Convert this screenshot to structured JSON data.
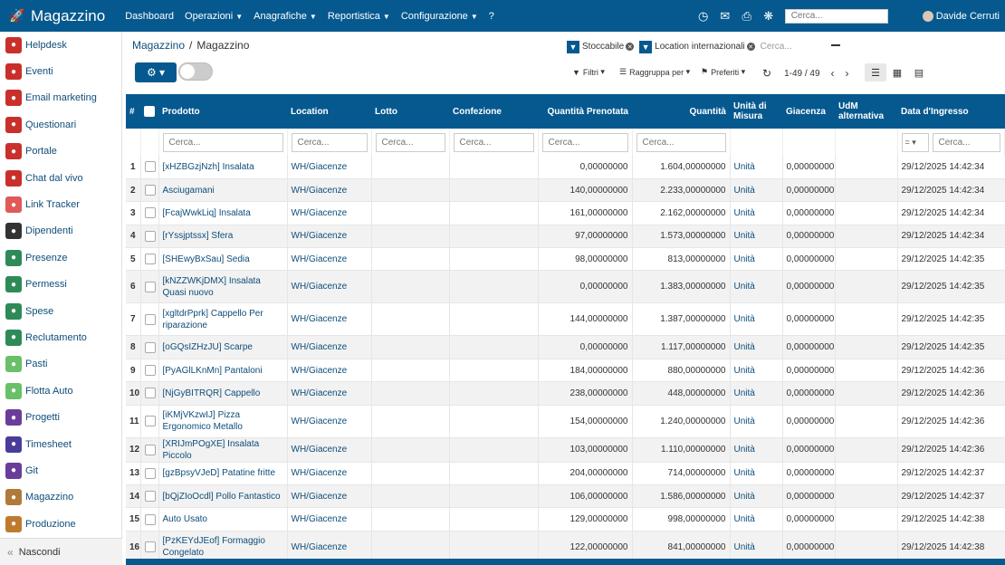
{
  "topbar": {
    "brand": "Magazzino",
    "menu": [
      "Dashboard",
      "Operazioni",
      "Anagrafiche",
      "Reportistica",
      "Configurazione",
      "?"
    ],
    "search_placeholder": "Cerca...",
    "user": "Davide Cerruti",
    "icons": [
      "rocket-icon",
      "clock-icon",
      "chat-icon",
      "print-icon",
      "loading-icon"
    ]
  },
  "sidebar": {
    "items": [
      {
        "label": "Helpdesk",
        "color": "#c9302c",
        "icon": "helpdesk-icon"
      },
      {
        "label": "Eventi",
        "color": "#c9302c",
        "icon": "ticket-icon"
      },
      {
        "label": "Email marketing",
        "color": "#c9302c",
        "icon": "paper-plane-icon"
      },
      {
        "label": "Questionari",
        "color": "#c9302c",
        "icon": "clipboard-icon"
      },
      {
        "label": "Portale",
        "color": "#c9302c",
        "icon": "globe-icon"
      },
      {
        "label": "Chat dal vivo",
        "color": "#c9302c",
        "icon": "chat-icon"
      },
      {
        "label": "Link Tracker",
        "color": "#e05a5a",
        "icon": "link-icon"
      },
      {
        "label": "Dipendenti",
        "color": "#333333",
        "icon": "people-icon"
      },
      {
        "label": "Presenze",
        "color": "#2e8b57",
        "icon": "person-icon"
      },
      {
        "label": "Permessi",
        "color": "#2e8b57",
        "icon": "sun-icon"
      },
      {
        "label": "Spese",
        "color": "#2e8b57",
        "icon": "dollar-icon"
      },
      {
        "label": "Reclutamento",
        "color": "#2e8b57",
        "icon": "search-person-icon"
      },
      {
        "label": "Pasti",
        "color": "#6abf69",
        "icon": "cutlery-icon"
      },
      {
        "label": "Flotta Auto",
        "color": "#6abf69",
        "icon": "car-icon"
      },
      {
        "label": "Progetti",
        "color": "#6a3d9a",
        "icon": "puzzle-icon"
      },
      {
        "label": "Timesheet",
        "color": "#4a3d9a",
        "icon": "clock-icon"
      },
      {
        "label": "Git",
        "color": "#6a3d9a",
        "icon": "git-icon"
      },
      {
        "label": "Magazzino",
        "color": "#b07a3a",
        "icon": "box-icon"
      },
      {
        "label": "Produzione",
        "color": "#c07a30",
        "icon": "wrench-icon"
      }
    ],
    "hide_label": "Nascondi"
  },
  "breadcrumb": {
    "parent": "Magazzino",
    "separator": "/",
    "current": "Magazzino"
  },
  "search": {
    "facets": [
      "Stoccabile",
      "Location internazionali"
    ],
    "placeholder": "Cerca..."
  },
  "toolbar": {
    "filters": "Filtri",
    "group_by": "Raggruppa per",
    "favorites": "Preferiti",
    "pager": "1-49 / 49"
  },
  "table": {
    "columns": [
      "#",
      "",
      "Prodotto",
      "Location",
      "Lotto",
      "Confezione",
      "Quantità Prenotata",
      "Quantità",
      "Unità di Misura",
      "Giacenza",
      "UdM alternativa",
      "Data d'Ingresso"
    ],
    "filter_placeholder": "Cerca...",
    "date_operator": "=",
    "rows": [
      {
        "idx": "1",
        "product": "[xHZBGzjNzh] Insalata",
        "location": "WH/Giacenze",
        "reserved": "0,00000000",
        "qty": "1.604,00000000",
        "uom": "Unità",
        "stock": "0,00000000",
        "date": "29/12/2025 14:42:34",
        "tall": false
      },
      {
        "idx": "2",
        "product": "Asciugamani",
        "location": "WH/Giacenze",
        "reserved": "140,00000000",
        "qty": "2.233,00000000",
        "uom": "Unità",
        "stock": "0,00000000",
        "date": "29/12/2025 14:42:34",
        "tall": false
      },
      {
        "idx": "3",
        "product": "[FcajWwkLiq] Insalata",
        "location": "WH/Giacenze",
        "reserved": "161,00000000",
        "qty": "2.162,00000000",
        "uom": "Unità",
        "stock": "0,00000000",
        "date": "29/12/2025 14:42:34",
        "tall": false
      },
      {
        "idx": "4",
        "product": "[rYssjptssx] Sfera",
        "location": "WH/Giacenze",
        "reserved": "97,00000000",
        "qty": "1.573,00000000",
        "uom": "Unità",
        "stock": "0,00000000",
        "date": "29/12/2025 14:42:34",
        "tall": false
      },
      {
        "idx": "5",
        "product": "[SHEwyBxSau] Sedia",
        "location": "WH/Giacenze",
        "reserved": "98,00000000",
        "qty": "813,00000000",
        "uom": "Unità",
        "stock": "0,00000000",
        "date": "29/12/2025 14:42:35",
        "tall": false
      },
      {
        "idx": "6",
        "product": "[kNZZWKjDMX] Insalata Quasi nuovo",
        "location": "WH/Giacenze",
        "reserved": "0,00000000",
        "qty": "1.383,00000000",
        "uom": "Unità",
        "stock": "0,00000000",
        "date": "29/12/2025 14:42:35",
        "tall": true
      },
      {
        "idx": "7",
        "product": "[xgltdrPprk] Cappello Per riparazione",
        "location": "WH/Giacenze",
        "reserved": "144,00000000",
        "qty": "1.387,00000000",
        "uom": "Unità",
        "stock": "0,00000000",
        "date": "29/12/2025 14:42:35",
        "tall": true
      },
      {
        "idx": "8",
        "product": "[oGQsIZHzJU] Scarpe",
        "location": "WH/Giacenze",
        "reserved": "0,00000000",
        "qty": "1.117,00000000",
        "uom": "Unità",
        "stock": "0,00000000",
        "date": "29/12/2025 14:42:35",
        "tall": false
      },
      {
        "idx": "9",
        "product": "[PyAGlLKnMn] Pantaloni",
        "location": "WH/Giacenze",
        "reserved": "184,00000000",
        "qty": "880,00000000",
        "uom": "Unità",
        "stock": "0,00000000",
        "date": "29/12/2025 14:42:36",
        "tall": false
      },
      {
        "idx": "10",
        "product": "[NjGyBITRQR] Cappello",
        "location": "WH/Giacenze",
        "reserved": "238,00000000",
        "qty": "448,00000000",
        "uom": "Unità",
        "stock": "0,00000000",
        "date": "29/12/2025 14:42:36",
        "tall": false
      },
      {
        "idx": "11",
        "product": "[iKMjVKzwIJ] Pizza Ergonomico Metallo",
        "location": "WH/Giacenze",
        "reserved": "154,00000000",
        "qty": "1.240,00000000",
        "uom": "Unità",
        "stock": "0,00000000",
        "date": "29/12/2025 14:42:36",
        "tall": true
      },
      {
        "idx": "12",
        "product": "[XRIJmPOgXE] Insalata Piccolo",
        "location": "WH/Giacenze",
        "reserved": "103,00000000",
        "qty": "1.110,00000000",
        "uom": "Unità",
        "stock": "0,00000000",
        "date": "29/12/2025 14:42:36",
        "tall": false
      },
      {
        "idx": "13",
        "product": "[gzBpsyVJeD] Patatine fritte",
        "location": "WH/Giacenze",
        "reserved": "204,00000000",
        "qty": "714,00000000",
        "uom": "Unità",
        "stock": "0,00000000",
        "date": "29/12/2025 14:42:37",
        "tall": false
      },
      {
        "idx": "14",
        "product": "[bQjZIoOcdl] Pollo Fantastico",
        "location": "WH/Giacenze",
        "reserved": "106,00000000",
        "qty": "1.586,00000000",
        "uom": "Unità",
        "stock": "0,00000000",
        "date": "29/12/2025 14:42:37",
        "tall": false
      },
      {
        "idx": "15",
        "product": "Auto Usato",
        "location": "WH/Giacenze",
        "reserved": "129,00000000",
        "qty": "998,00000000",
        "uom": "Unità",
        "stock": "0,00000000",
        "date": "29/12/2025 14:42:38",
        "tall": false
      },
      {
        "idx": "16",
        "product": "[PzKEYdJEof] Formaggio Congelato",
        "location": "WH/Giacenze",
        "reserved": "122,00000000",
        "qty": "841,00000000",
        "uom": "Unità",
        "stock": "0,00000000",
        "date": "29/12/2025 14:42:38",
        "tall": true
      }
    ]
  }
}
